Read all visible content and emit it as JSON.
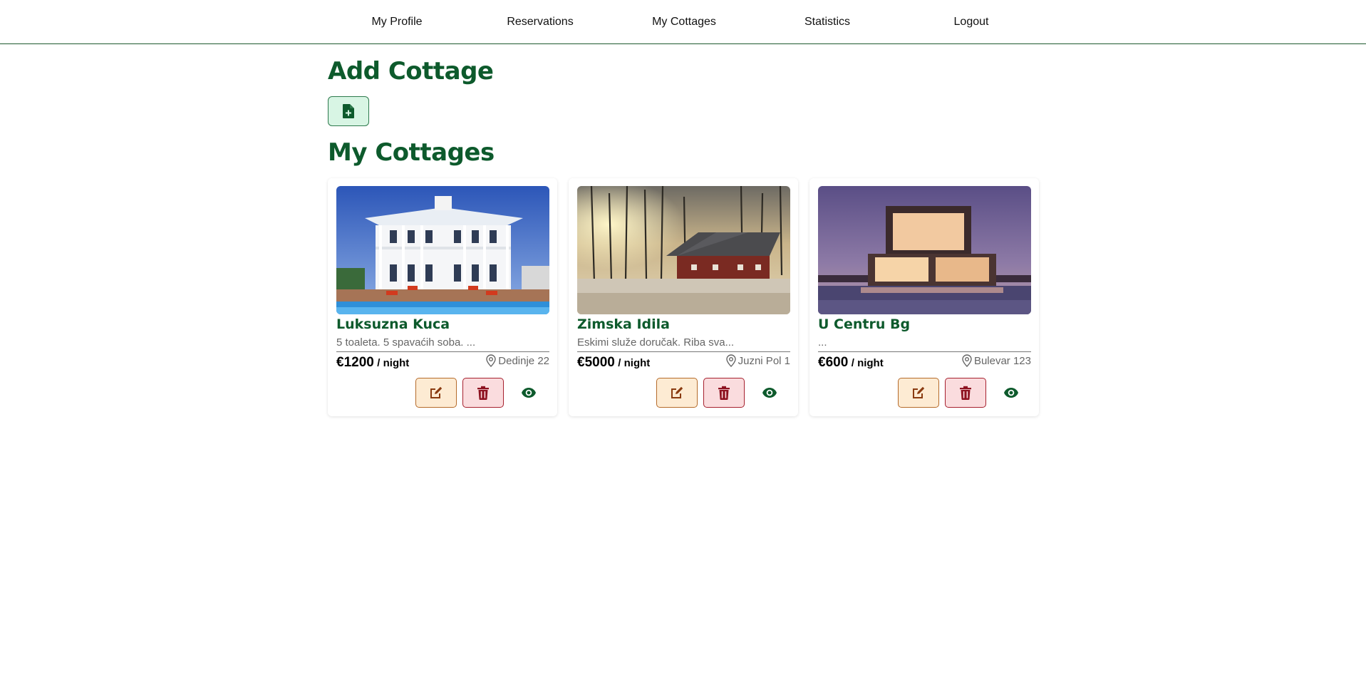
{
  "nav": {
    "items": [
      "My Profile",
      "Reservations",
      "My Cottages",
      "Statistics",
      "Logout"
    ]
  },
  "add_section": {
    "title": "Add Cottage",
    "button_icon": "file-plus-icon"
  },
  "cottages_section": {
    "title": "My Cottages"
  },
  "cottages": [
    {
      "name": "Luksuzna Kuca",
      "description": "5 toaleta. 5 spavaćih soba. ...",
      "price": "€1200",
      "price_unit": "/ night",
      "location": "Dedinje 22",
      "image": "white-mansion-with-pool"
    },
    {
      "name": "Zimska Idila",
      "description": "Eskimi služe doručak. Riba sva...",
      "price": "€5000",
      "price_unit": "/ night",
      "location": "Juzni Pol 1",
      "image": "red-cabin-in-snow"
    },
    {
      "name": "U Centru Bg",
      "description": "...",
      "price": "€600",
      "price_unit": "/ night",
      "location": "Bulevar 123",
      "image": "modern-cube-house-at-dusk"
    }
  ],
  "icons": {
    "edit": "edit-icon",
    "delete": "trash-icon",
    "view": "eye-icon",
    "location": "map-pin-icon"
  },
  "colors": {
    "primary_green": "#0d5a2c",
    "nav_border": "#1f5a2f",
    "add_button_bg": "#d8f5e4",
    "edit_button_bg": "#fdebd3",
    "edit_accent": "#8a3b10",
    "delete_button_bg": "#fadcde",
    "delete_accent": "#8d1220"
  }
}
